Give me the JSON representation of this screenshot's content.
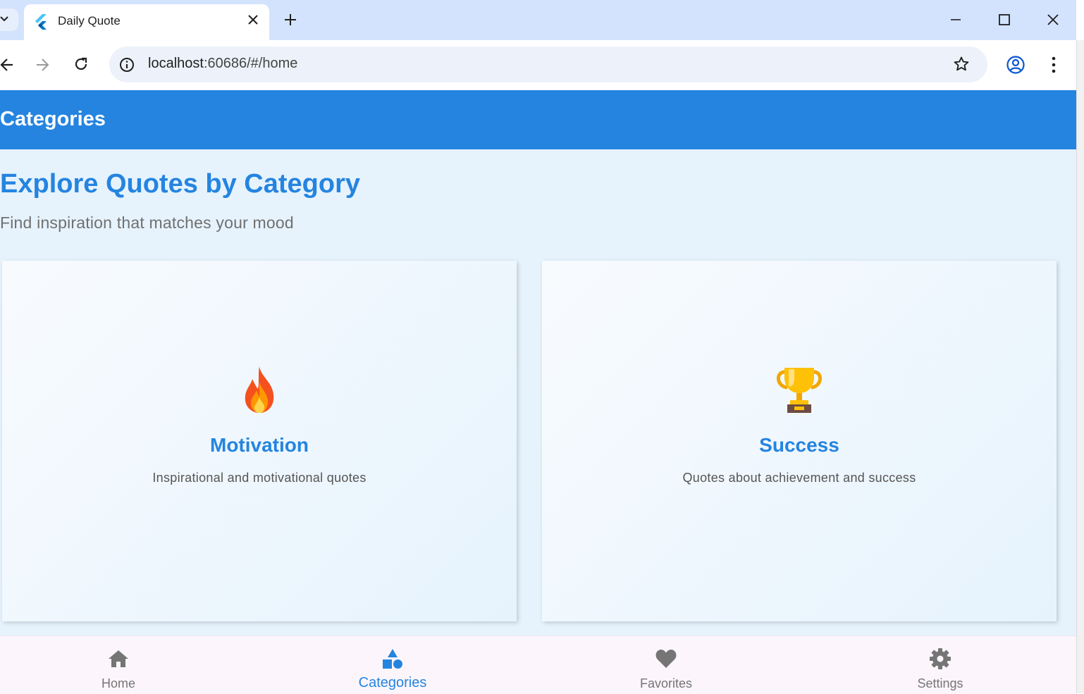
{
  "browser": {
    "tab_title": "Daily Quote",
    "url_host": "localhost",
    "url_rest": ":60686/#/home"
  },
  "app": {
    "appbar_title": "Categories",
    "headline": "Explore Quotes by Category",
    "subheadline": "Find inspiration that matches your mood",
    "categories": [
      {
        "emoji": "🔥",
        "name": "Motivation",
        "description": "Inspirational and motivational quotes"
      },
      {
        "emoji": "🏆",
        "name": "Success",
        "description": "Quotes about achievement and success"
      }
    ],
    "bottom_nav": [
      {
        "label": "Home",
        "icon": "home-icon"
      },
      {
        "label": "Categories",
        "icon": "category-icon",
        "active": true
      },
      {
        "label": "Favorites",
        "icon": "heart-icon"
      },
      {
        "label": "Settings",
        "icon": "gear-icon"
      }
    ]
  },
  "colors": {
    "primary": "#2584e0",
    "content_bg": "#e6f3fd",
    "inactive_nav": "#757575"
  }
}
